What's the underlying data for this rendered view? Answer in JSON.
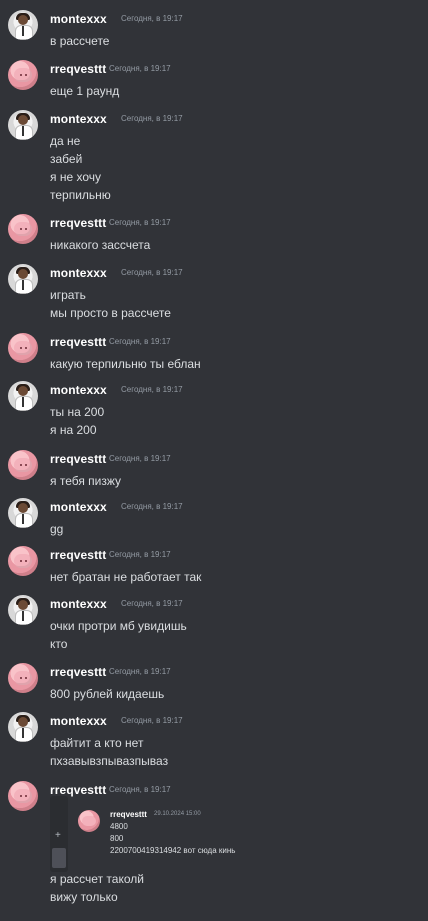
{
  "timestamps": {
    "today_1917": "Сегодня, в 19:17"
  },
  "users": {
    "montexxx": "montexxx",
    "rreqvesttt": "rreqvesttt"
  },
  "messages": [
    {
      "user": "montexxx",
      "lines": [
        "в рассчете"
      ]
    },
    {
      "user": "rreqvesttt",
      "lines": [
        "еще 1 раунд"
      ]
    },
    {
      "user": "montexxx",
      "lines": [
        "да не",
        "забей",
        "я не хочу",
        "терпильню"
      ]
    },
    {
      "user": "rreqvesttt",
      "lines": [
        "никакого зассчета"
      ]
    },
    {
      "user": "montexxx",
      "lines": [
        "играть",
        "мы просто в рассчете"
      ]
    },
    {
      "user": "rreqvesttt",
      "lines": [
        "какую терпильню ты еблан"
      ]
    },
    {
      "user": "montexxx",
      "lines": [
        "ты на 200",
        "я на 200"
      ]
    },
    {
      "user": "rreqvesttt",
      "lines": [
        "я тебя пизжу"
      ]
    },
    {
      "user": "montexxx",
      "lines": [
        "gg"
      ]
    },
    {
      "user": "rreqvesttt",
      "lines": [
        "нет братан не работает так"
      ]
    },
    {
      "user": "montexxx",
      "lines": [
        "очки протри мб увидишь",
        "кто"
      ]
    },
    {
      "user": "rreqvesttt",
      "lines": [
        "800 рублей кидаешь"
      ]
    },
    {
      "user": "montexxx",
      "lines": [
        "файтит а кто нет",
        "пхзавывзпывазпываз"
      ]
    },
    {
      "user": "rreqvesttt",
      "lines": [
        "я рассчет таколй",
        "вижу только"
      ]
    }
  ],
  "quote": {
    "user": "rreqvesttt",
    "timestamp": "29.10.2024 15:00",
    "lines": [
      "4800",
      "800",
      "2200700419314942 вот сюда кинь"
    ],
    "toolbar_plus": "+"
  }
}
